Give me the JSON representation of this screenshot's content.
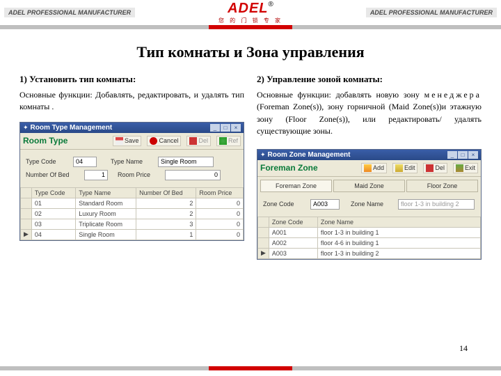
{
  "header": {
    "side": "ADEL PROFESSIONAL MANUFACTURER",
    "logo": "ADEL",
    "reg": "®",
    "sub": "您 的 门 锁 专 家"
  },
  "title": "Тип комнаты и Зона управления",
  "left": {
    "h": "1) Установить тип комнаты:",
    "p": "Основные функции: Добавлять, редактировать, и удалять тип комнаты .",
    "win_title": "Room Type Management",
    "panel": "Room Type",
    "btn": {
      "save": "Save",
      "cancel": "Cancel",
      "del": "Del",
      "ref": "Ref"
    },
    "fields": {
      "type_code_l": "Type Code",
      "type_code_v": "04",
      "type_name_l": "Type Name",
      "type_name_v": "Single Room",
      "num_bed_l": "Number Of Bed",
      "num_bed_v": "1",
      "room_price_l": "Room Price",
      "room_price_v": "0"
    },
    "cols": [
      "Type Code",
      "Type Name",
      "Number Of Bed",
      "Room Price"
    ],
    "rows": [
      [
        "01",
        "Standard Room",
        "2",
        "0"
      ],
      [
        "02",
        "Luxury Room",
        "2",
        "0"
      ],
      [
        "03",
        "Triplicate Room",
        "3",
        "0"
      ],
      [
        "04",
        "Single Room",
        "1",
        "0"
      ]
    ]
  },
  "right": {
    "h": "2) Управление зоной комнаты:",
    "p1": "Основные функции: добавлять новую зону ",
    "mgr": "менеджера",
    "p2": " (Foreman Zone(s)), зону горничной (Maid Zone(s))и этажную зону (Floor Zone(s)), или редактировать/ удалять существующие зоны.",
    "win_title": "Room Zone Management",
    "panel": "Foreman Zone",
    "btn": {
      "add": "Add",
      "edit": "Edit",
      "del": "Del",
      "exit": "Exit"
    },
    "tabs": [
      "Foreman Zone",
      "Maid Zone",
      "Floor Zone"
    ],
    "fields": {
      "zone_code_l": "Zone Code",
      "zone_code_v": "A003",
      "zone_name_l": "Zone Name",
      "zone_name_v": "floor 1-3 in building 2"
    },
    "cols": [
      "Zone Code",
      "Zone Name"
    ],
    "rows": [
      [
        "A001",
        "floor 1-3 in building 1"
      ],
      [
        "A002",
        "floor 4-6 in building 1"
      ],
      [
        "A003",
        "floor 1-3 in building 2"
      ]
    ]
  },
  "page": "14"
}
